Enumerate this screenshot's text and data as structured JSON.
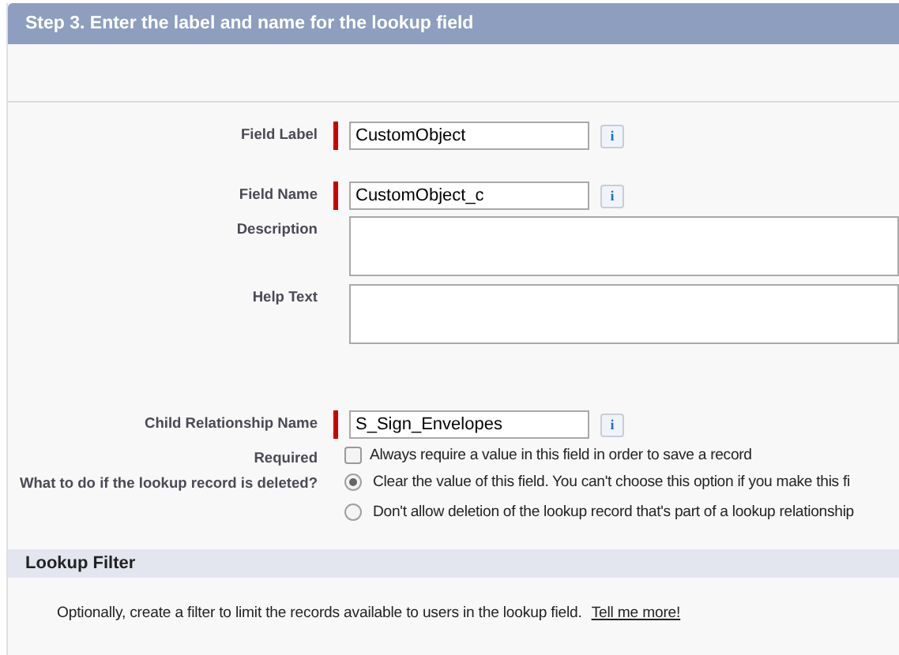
{
  "step_header": {
    "title": "Step 3. Enter the label and name for the lookup field"
  },
  "fields": [
    {
      "kind": "text",
      "label": "Field Label",
      "value": "CustomObject",
      "required": true,
      "info": "i"
    },
    {
      "kind": "text",
      "label": "Field Name",
      "value": "CustomObject_c",
      "required": true,
      "info": "i"
    },
    {
      "kind": "textarea",
      "label": "Description"
    },
    {
      "kind": "textarea",
      "label": "Help Text"
    },
    {
      "kind": "text",
      "label": "Child Relationship Name",
      "value": "S_Sign_Envelopes",
      "required": true,
      "info": "i"
    },
    {
      "kind": "checkbox",
      "label": "Required",
      "text": "Always require a value in this field in order to save a record",
      "checked": false
    },
    {
      "kind": "radio",
      "label": "What to do if the lookup record is deleted?",
      "options": [
        {
          "text": "Clear the value of this field. You can't choose this option if you make this fi",
          "selected": true
        },
        {
          "text": "Don't allow deletion of the lookup record that's part of a lookup relationship",
          "selected": false
        }
      ]
    }
  ],
  "lookup_filter": {
    "title": "Lookup Filter",
    "text": "Optionally, create a filter to limit the records available to users in the lookup field.",
    "link": "Tell me more!"
  }
}
